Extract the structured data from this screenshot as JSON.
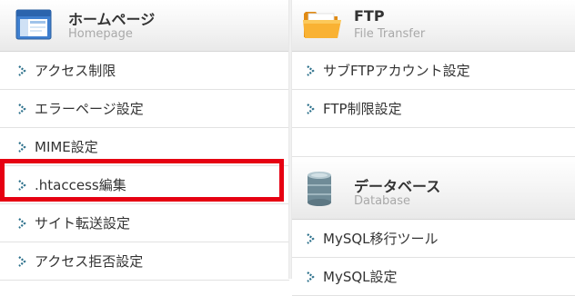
{
  "homepage": {
    "title": "ホームページ",
    "subtitle": "Homepage",
    "icon": "browser-window-icon",
    "items": [
      {
        "label": "アクセス制限"
      },
      {
        "label": "エラーページ設定"
      },
      {
        "label": "MIME設定"
      },
      {
        "label": ".htaccess編集"
      },
      {
        "label": "サイト転送設定"
      },
      {
        "label": "アクセス拒否設定"
      }
    ]
  },
  "ftp": {
    "title": "FTP",
    "subtitle": "File Transfer",
    "icon": "folder-icon",
    "items": [
      {
        "label": "サブFTPアカウント設定"
      },
      {
        "label": "FTP制限設定"
      }
    ]
  },
  "database": {
    "title": "データベース",
    "subtitle": "Database",
    "icon": "database-icon",
    "items": [
      {
        "label": "MySQL移行ツール"
      },
      {
        "label": "MySQL設定"
      }
    ]
  },
  "highlighted_item": ".htaccess編集",
  "colors": {
    "highlight": "#e60012",
    "arrow": "#2a6f8a",
    "text": "#333333",
    "subtitle": "#a9a9a9"
  }
}
